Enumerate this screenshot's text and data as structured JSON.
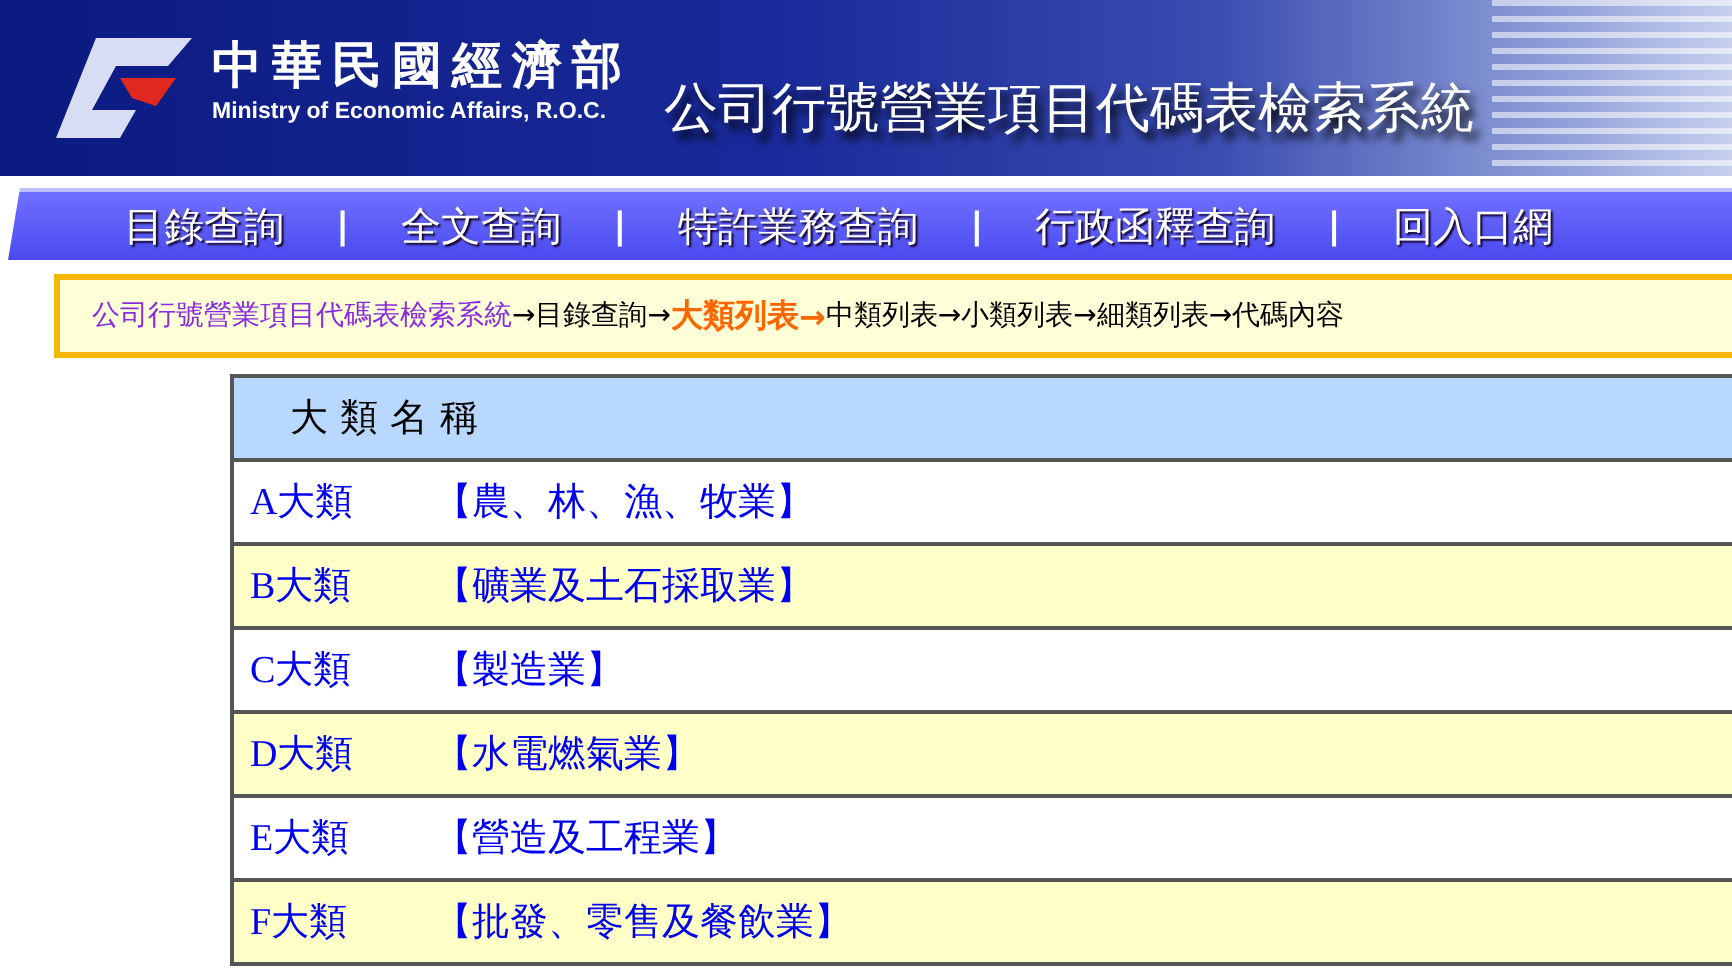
{
  "header": {
    "agency_name": "中華民國經濟部",
    "agency_name_en": "Ministry of Economic Affairs, R.O.C.",
    "system_title": "公司行號營業項目代碼表檢索系統"
  },
  "nav": {
    "items": [
      {
        "label": "目錄查詢",
        "separator": "|"
      },
      {
        "label": "全文查詢",
        "separator": "|"
      },
      {
        "label": "特許業務查詢",
        "separator": "|"
      },
      {
        "label": "行政函釋查詢",
        "separator": "|"
      },
      {
        "label": "回入口網"
      }
    ]
  },
  "breadcrumb": [
    {
      "label": "公司行號營業項目代碼表檢索系統",
      "kind": "link",
      "separator": "→"
    },
    {
      "label": "目錄查詢",
      "kind": "plain",
      "separator": "→"
    },
    {
      "label": "大類列表",
      "kind": "current",
      "separator": "→"
    },
    {
      "label": "中類列表",
      "kind": "plain",
      "separator": "→"
    },
    {
      "label": "小類列表",
      "kind": "plain",
      "separator": "→"
    },
    {
      "label": "細類列表",
      "kind": "plain",
      "separator": "→"
    },
    {
      "label": "代碼內容",
      "kind": "plain"
    }
  ],
  "table": {
    "column_header": "大 類 名 稱",
    "rows": [
      {
        "code": "A大類",
        "name": "【農、林、漁、牧業】"
      },
      {
        "code": "B大類",
        "name": "【礦業及土石採取業】"
      },
      {
        "code": "C大類",
        "name": "【製造業】"
      },
      {
        "code": "D大類",
        "name": "【水電燃氣業】"
      },
      {
        "code": "E大類",
        "name": "【營造及工程業】"
      },
      {
        "code": "F大類",
        "name": "【批發、零售及餐飲業】"
      }
    ]
  }
}
